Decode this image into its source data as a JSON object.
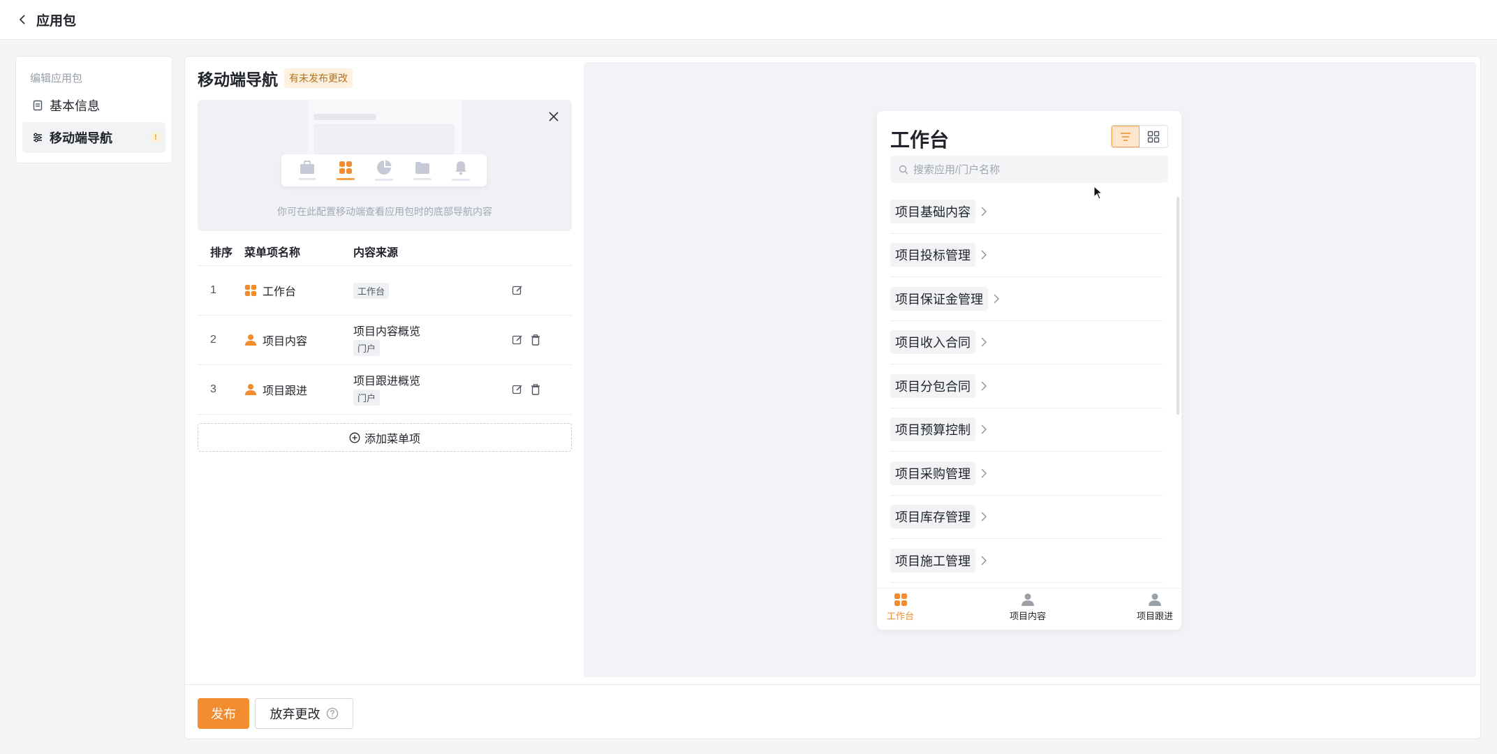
{
  "header": {
    "title": "应用包",
    "back_icon": "chevron-left-icon"
  },
  "sidebar": {
    "group_label": "编辑应用包",
    "items": [
      {
        "label": "基本信息",
        "icon": "document-icon",
        "active": false
      },
      {
        "label": "移动端导航",
        "icon": "sliders-icon",
        "active": true,
        "badge": "!"
      }
    ]
  },
  "config": {
    "title": "移动端导航",
    "status_badge": "有未发布更改",
    "banner_hint": "你可在此配置移动端查看应用包时的底部导航内容",
    "columns": {
      "order": "排序",
      "name": "菜单项名称",
      "source": "内容来源"
    },
    "rows": [
      {
        "order": "1",
        "name": "工作台",
        "icon": "grid-icon",
        "source": "",
        "source_tag": "工作台",
        "deletable": false
      },
      {
        "order": "2",
        "name": "项目内容",
        "icon": "person-icon",
        "source": "项目内容概览",
        "source_tag": "门户",
        "deletable": true
      },
      {
        "order": "3",
        "name": "项目跟进",
        "icon": "person-icon",
        "source": "项目跟进概览",
        "source_tag": "门户",
        "deletable": true
      }
    ],
    "add_label": "添加菜单项"
  },
  "preview": {
    "title": "工作台",
    "search_placeholder": "搜索应用/门户名称",
    "view_modes": [
      "list",
      "grid"
    ],
    "active_view": "list",
    "items": [
      "项目基础内容",
      "项目投标管理",
      "项目保证金管理",
      "项目收入合同",
      "项目分包合同",
      "项目预算控制",
      "项目采购管理",
      "项目库存管理",
      "项目施工管理"
    ],
    "nav": [
      {
        "label": "工作台",
        "active": true
      },
      {
        "label": "项目内容",
        "active": false
      },
      {
        "label": "项目跟进",
        "active": false
      }
    ]
  },
  "footer": {
    "publish_label": "发布",
    "discard_label": "放弃更改"
  },
  "colors": {
    "accent": "#f28c2e",
    "warning_bg": "#fdf1dd",
    "preview_bg": "#f2f3f6"
  }
}
